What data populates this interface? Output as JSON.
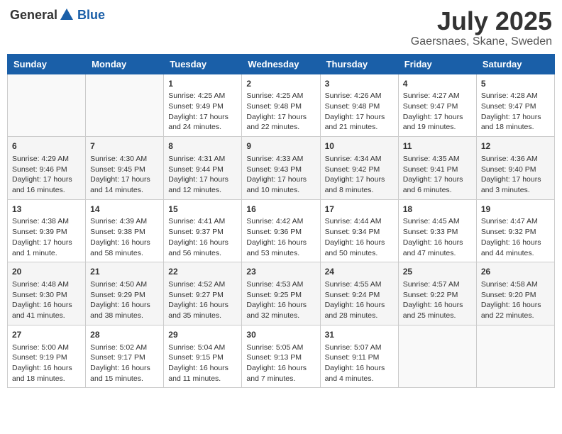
{
  "header": {
    "logo_general": "General",
    "logo_blue": "Blue",
    "month_title": "July 2025",
    "location": "Gaersnaes, Skane, Sweden"
  },
  "weekdays": [
    "Sunday",
    "Monday",
    "Tuesday",
    "Wednesday",
    "Thursday",
    "Friday",
    "Saturday"
  ],
  "weeks": [
    [
      {
        "day": "",
        "content": ""
      },
      {
        "day": "",
        "content": ""
      },
      {
        "day": "1",
        "content": "Sunrise: 4:25 AM\nSunset: 9:49 PM\nDaylight: 17 hours and 24 minutes."
      },
      {
        "day": "2",
        "content": "Sunrise: 4:25 AM\nSunset: 9:48 PM\nDaylight: 17 hours and 22 minutes."
      },
      {
        "day": "3",
        "content": "Sunrise: 4:26 AM\nSunset: 9:48 PM\nDaylight: 17 hours and 21 minutes."
      },
      {
        "day": "4",
        "content": "Sunrise: 4:27 AM\nSunset: 9:47 PM\nDaylight: 17 hours and 19 minutes."
      },
      {
        "day": "5",
        "content": "Sunrise: 4:28 AM\nSunset: 9:47 PM\nDaylight: 17 hours and 18 minutes."
      }
    ],
    [
      {
        "day": "6",
        "content": "Sunrise: 4:29 AM\nSunset: 9:46 PM\nDaylight: 17 hours and 16 minutes."
      },
      {
        "day": "7",
        "content": "Sunrise: 4:30 AM\nSunset: 9:45 PM\nDaylight: 17 hours and 14 minutes."
      },
      {
        "day": "8",
        "content": "Sunrise: 4:31 AM\nSunset: 9:44 PM\nDaylight: 17 hours and 12 minutes."
      },
      {
        "day": "9",
        "content": "Sunrise: 4:33 AM\nSunset: 9:43 PM\nDaylight: 17 hours and 10 minutes."
      },
      {
        "day": "10",
        "content": "Sunrise: 4:34 AM\nSunset: 9:42 PM\nDaylight: 17 hours and 8 minutes."
      },
      {
        "day": "11",
        "content": "Sunrise: 4:35 AM\nSunset: 9:41 PM\nDaylight: 17 hours and 6 minutes."
      },
      {
        "day": "12",
        "content": "Sunrise: 4:36 AM\nSunset: 9:40 PM\nDaylight: 17 hours and 3 minutes."
      }
    ],
    [
      {
        "day": "13",
        "content": "Sunrise: 4:38 AM\nSunset: 9:39 PM\nDaylight: 17 hours and 1 minute."
      },
      {
        "day": "14",
        "content": "Sunrise: 4:39 AM\nSunset: 9:38 PM\nDaylight: 16 hours and 58 minutes."
      },
      {
        "day": "15",
        "content": "Sunrise: 4:41 AM\nSunset: 9:37 PM\nDaylight: 16 hours and 56 minutes."
      },
      {
        "day": "16",
        "content": "Sunrise: 4:42 AM\nSunset: 9:36 PM\nDaylight: 16 hours and 53 minutes."
      },
      {
        "day": "17",
        "content": "Sunrise: 4:44 AM\nSunset: 9:34 PM\nDaylight: 16 hours and 50 minutes."
      },
      {
        "day": "18",
        "content": "Sunrise: 4:45 AM\nSunset: 9:33 PM\nDaylight: 16 hours and 47 minutes."
      },
      {
        "day": "19",
        "content": "Sunrise: 4:47 AM\nSunset: 9:32 PM\nDaylight: 16 hours and 44 minutes."
      }
    ],
    [
      {
        "day": "20",
        "content": "Sunrise: 4:48 AM\nSunset: 9:30 PM\nDaylight: 16 hours and 41 minutes."
      },
      {
        "day": "21",
        "content": "Sunrise: 4:50 AM\nSunset: 9:29 PM\nDaylight: 16 hours and 38 minutes."
      },
      {
        "day": "22",
        "content": "Sunrise: 4:52 AM\nSunset: 9:27 PM\nDaylight: 16 hours and 35 minutes."
      },
      {
        "day": "23",
        "content": "Sunrise: 4:53 AM\nSunset: 9:25 PM\nDaylight: 16 hours and 32 minutes."
      },
      {
        "day": "24",
        "content": "Sunrise: 4:55 AM\nSunset: 9:24 PM\nDaylight: 16 hours and 28 minutes."
      },
      {
        "day": "25",
        "content": "Sunrise: 4:57 AM\nSunset: 9:22 PM\nDaylight: 16 hours and 25 minutes."
      },
      {
        "day": "26",
        "content": "Sunrise: 4:58 AM\nSunset: 9:20 PM\nDaylight: 16 hours and 22 minutes."
      }
    ],
    [
      {
        "day": "27",
        "content": "Sunrise: 5:00 AM\nSunset: 9:19 PM\nDaylight: 16 hours and 18 minutes."
      },
      {
        "day": "28",
        "content": "Sunrise: 5:02 AM\nSunset: 9:17 PM\nDaylight: 16 hours and 15 minutes."
      },
      {
        "day": "29",
        "content": "Sunrise: 5:04 AM\nSunset: 9:15 PM\nDaylight: 16 hours and 11 minutes."
      },
      {
        "day": "30",
        "content": "Sunrise: 5:05 AM\nSunset: 9:13 PM\nDaylight: 16 hours and 7 minutes."
      },
      {
        "day": "31",
        "content": "Sunrise: 5:07 AM\nSunset: 9:11 PM\nDaylight: 16 hours and 4 minutes."
      },
      {
        "day": "",
        "content": ""
      },
      {
        "day": "",
        "content": ""
      }
    ]
  ]
}
